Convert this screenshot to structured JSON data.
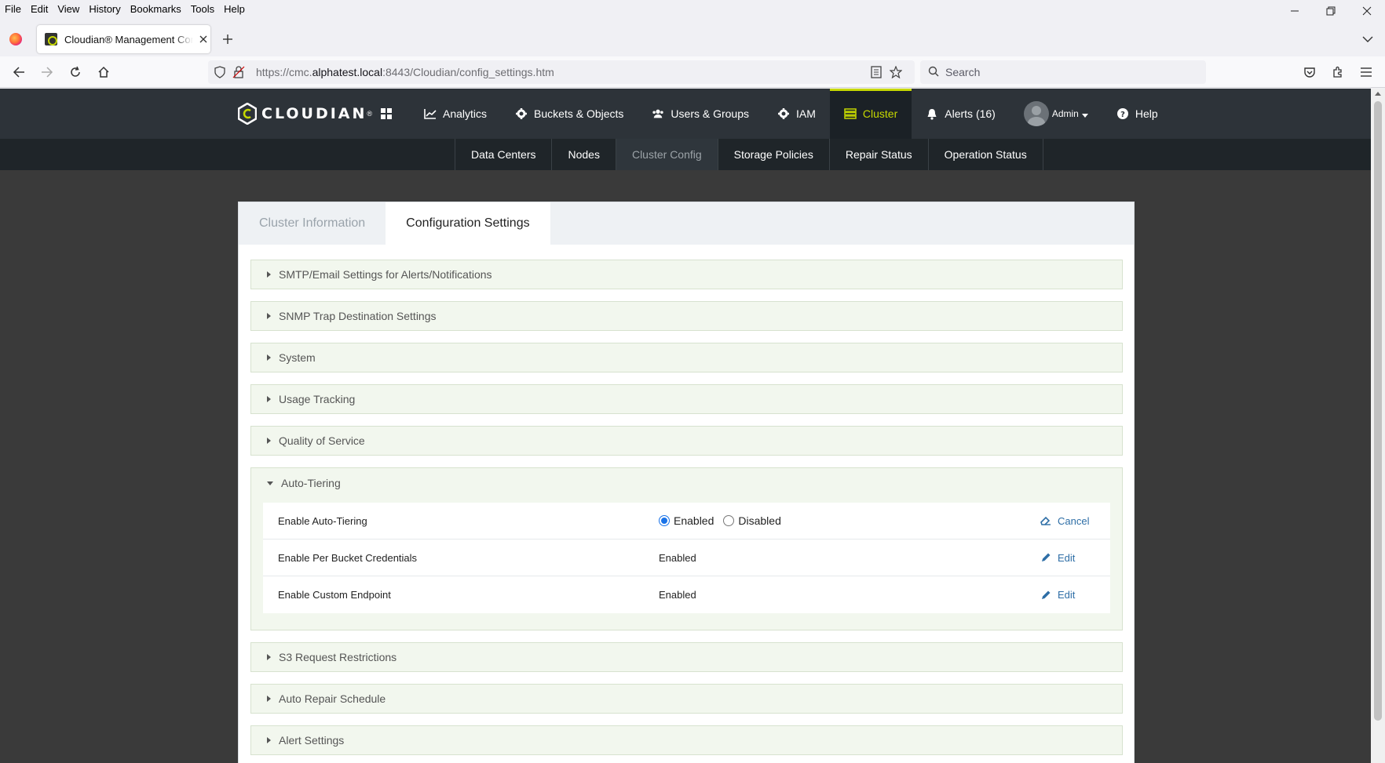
{
  "browser": {
    "menu": [
      "File",
      "Edit",
      "View",
      "History",
      "Bookmarks",
      "Tools",
      "Help"
    ],
    "tab_title": "Cloudian® Management Console",
    "url_prefix": "https://cmc.",
    "url_host": "alphatest.local",
    "url_rest": ":8443/Cloudian/config_settings.htm",
    "search_placeholder": "Search"
  },
  "app": {
    "brand": "CLOUDIAN",
    "brand_tm": "®",
    "topnav": {
      "analytics": "Analytics",
      "buckets": "Buckets & Objects",
      "users": "Users & Groups",
      "iam": "IAM",
      "cluster": "Cluster",
      "alerts": "Alerts (16)",
      "admin": "Admin",
      "help": "Help"
    },
    "subnav": [
      "Data Centers",
      "Nodes",
      "Cluster Config",
      "Storage Policies",
      "Repair Status",
      "Operation Status"
    ],
    "subnav_active": "Cluster Config",
    "panel_tabs": [
      "Cluster Information",
      "Configuration Settings"
    ],
    "sections": {
      "smtp": "SMTP/Email Settings for Alerts/Notifications",
      "snmp": "SNMP Trap Destination Settings",
      "system": "System",
      "usage": "Usage Tracking",
      "qos": "Quality of Service",
      "autotier": "Auto-Tiering",
      "s3": "S3 Request Restrictions",
      "repair": "Auto Repair Schedule",
      "alert": "Alert Settings"
    },
    "autotier_rows": {
      "r1_label": "Enable Auto-Tiering",
      "r1_opt_enabled": "Enabled",
      "r1_opt_disabled": "Disabled",
      "r1_action": "Cancel",
      "r2_label": "Enable Per Bucket Credentials",
      "r2_value": "Enabled",
      "r2_action": "Edit",
      "r3_label": "Enable Custom Endpoint",
      "r3_value": "Enabled",
      "r3_action": "Edit"
    }
  }
}
